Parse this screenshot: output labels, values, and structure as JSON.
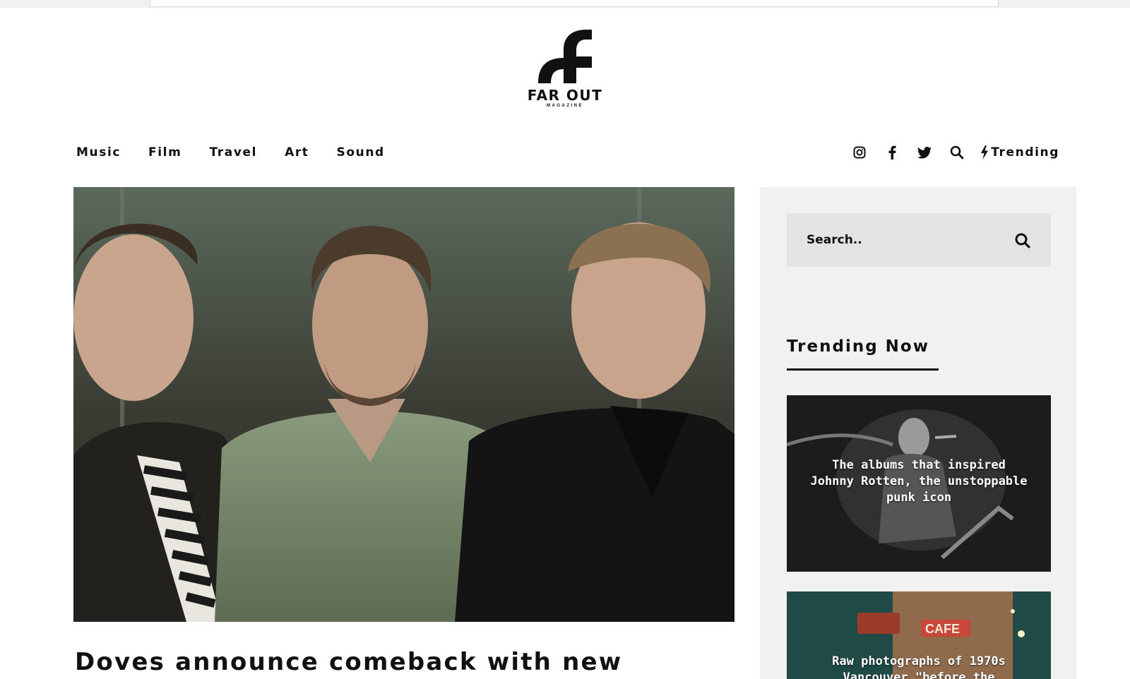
{
  "brand": {
    "name": "FAR OUT",
    "sub": "MAGAZINE"
  },
  "nav": {
    "items": [
      {
        "label": "Music"
      },
      {
        "label": "Film"
      },
      {
        "label": "Travel"
      },
      {
        "label": "Art"
      },
      {
        "label": "Sound"
      }
    ],
    "trending_label": "Trending",
    "icons": [
      "instagram-icon",
      "facebook-icon",
      "twitter-icon",
      "search-icon",
      "bolt-icon"
    ]
  },
  "article": {
    "headline": "Doves announce comeback with new"
  },
  "sidebar": {
    "search_placeholder": "Search..",
    "trending_title": "Trending Now",
    "cards": [
      {
        "title": "The albums that inspired Johnny Rotten, the unstoppable punk icon"
      },
      {
        "title": "Raw photographs of 1970s Vancouver \"before the"
      }
    ]
  },
  "colors": {
    "text": "#111111",
    "sidebar_bg": "#f1f1f1",
    "search_bg": "#e3e3e3"
  }
}
